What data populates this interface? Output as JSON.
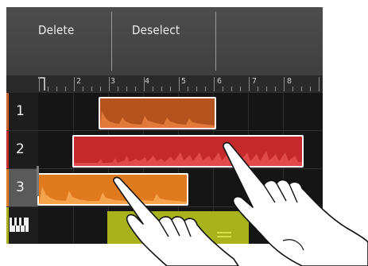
{
  "toolbar": {
    "delete_label": "Delete",
    "deselect_label": "Deselect"
  },
  "ruler": {
    "bars": [
      "1",
      "2",
      "3",
      "4",
      "5",
      "6",
      "7",
      "8"
    ]
  },
  "tracks": [
    {
      "label": "1",
      "color": "#c8622a"
    },
    {
      "label": "2",
      "color": "#c52a2a"
    },
    {
      "label": "3",
      "color": "#e07a1e"
    },
    {
      "label": "",
      "icon": "keyboard-icon",
      "color": "#a8b21a"
    }
  ],
  "colors": {
    "accent_orange": "#d9721c",
    "accent_red": "#c52a2a",
    "accent_green": "#a8b21a"
  }
}
